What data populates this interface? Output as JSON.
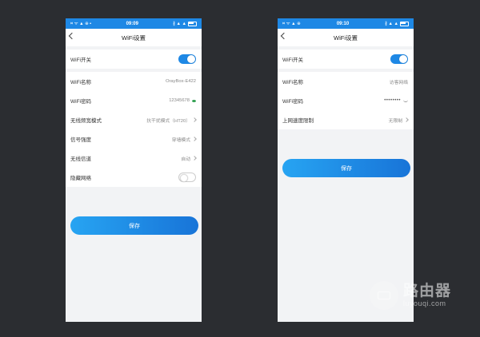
{
  "phone1": {
    "status": {
      "left_icons": "⌗ ᯤ ▲ ⊕ ▪",
      "time": "09:09",
      "right_icons": "∦ ▲ ▲"
    },
    "title": "WiFi设置",
    "wifi_switch": {
      "label": "WiFi开关",
      "on": true
    },
    "rows": [
      {
        "label": "WiFi名称",
        "value": "OrayBox-E422"
      },
      {
        "label": "WiFi密码",
        "value": "12345678"
      },
      {
        "label": "无线频宽模式",
        "value": "抗干扰模式（HT20）"
      },
      {
        "label": "信号强度",
        "value": "穿墙模式"
      },
      {
        "label": "无线信道",
        "value": "自动"
      },
      {
        "label": "隐藏网络",
        "on": false
      }
    ],
    "save": "保存"
  },
  "phone2": {
    "status": {
      "left_icons": "⌗ ᯤ ▲ ⊕",
      "time": "09:10",
      "right_icons": "∦ ▲ ▲"
    },
    "title": "WiFi设置",
    "wifi_switch": {
      "label": "WiFi开关",
      "on": true
    },
    "rows": [
      {
        "label": "WiFi名称",
        "value": "访客网络"
      },
      {
        "label": "WiFi密码",
        "value": "••••••••"
      },
      {
        "label": "上网速度限制",
        "value": "无限制"
      }
    ],
    "save": "保存"
  },
  "watermark": {
    "main": "路由器",
    "sub": "luyouqi.com"
  },
  "colors": {
    "accent": "#1e88e5",
    "background": "#2b2d31"
  }
}
